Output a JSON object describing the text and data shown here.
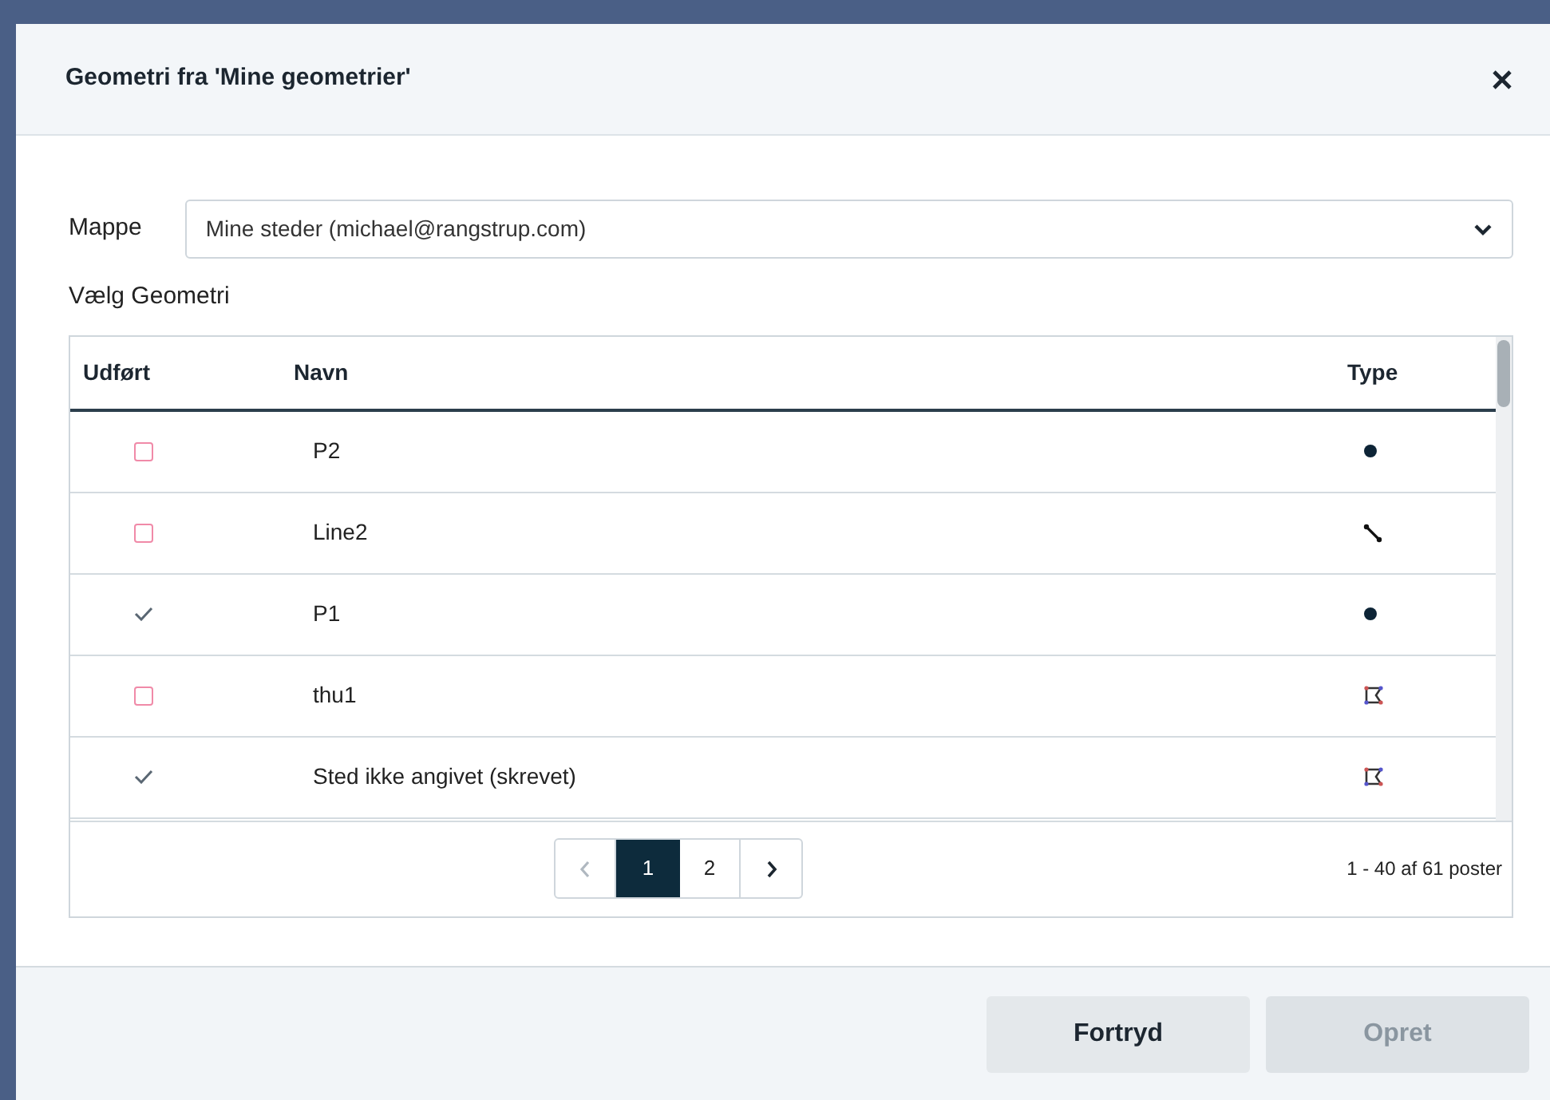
{
  "dialog": {
    "title": "Geometri fra 'Mine geometrier'"
  },
  "folder": {
    "label": "Mappe",
    "value": "Mine steder (michael@rangstrup.com)"
  },
  "section_label": "Vælg Geometri",
  "table": {
    "columns": [
      "Udført",
      "Navn",
      "Type"
    ],
    "rows": [
      {
        "done": false,
        "name": "P2",
        "kind": "point"
      },
      {
        "done": false,
        "name": "Line2",
        "kind": "line"
      },
      {
        "done": true,
        "name": "P1",
        "kind": "point"
      },
      {
        "done": false,
        "name": "thu1",
        "kind": "polygon"
      },
      {
        "done": true,
        "name": "Sted ikke angivet (skrevet)",
        "kind": "polygon"
      }
    ]
  },
  "pagination": {
    "prev_disabled": true,
    "pages": [
      {
        "label": "1",
        "selected": true
      },
      {
        "label": "2",
        "selected": false
      }
    ],
    "next_disabled": false,
    "summary": "1 - 40 af 61 poster"
  },
  "buttons": [
    {
      "label": "Fortryd",
      "disabled": false
    },
    {
      "label": "Opret",
      "disabled": true
    }
  ]
}
